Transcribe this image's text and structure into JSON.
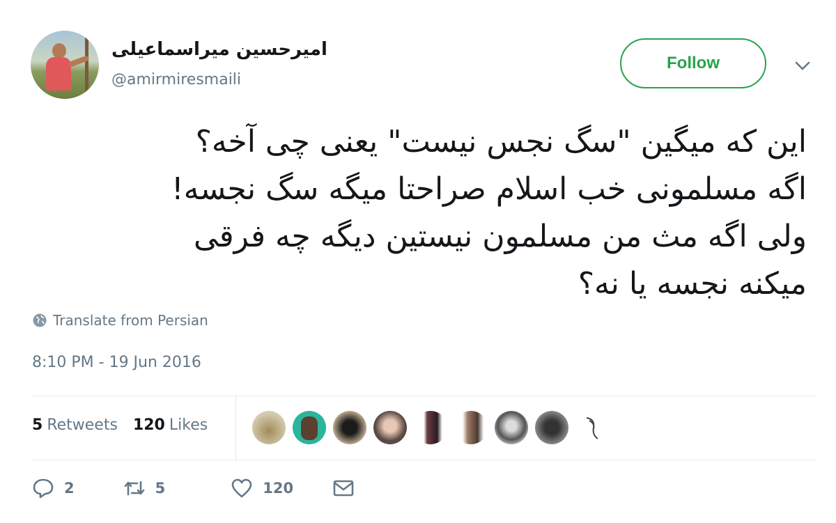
{
  "author": {
    "display_name": "امیرحسین میراسماعیلی",
    "username": "@amirmiresmaili",
    "avatar": "user-avatar"
  },
  "follow_button": {
    "label": "Follow",
    "color": "#27a34a"
  },
  "menu": {
    "icon": "chevron-down-icon"
  },
  "tweet": {
    "lines": [
      "این که میگین \"سگ نجس نیست\" یعنی چی آخه؟",
      "اگه مسلمونی خب اسلام صراحتا میگه سگ نجسه!",
      "ولی اگه مث من مسلمون نیستین دیگه چه فرقی",
      "میکنه نجسه یا نه؟"
    ]
  },
  "translate": {
    "label": "Translate from Persian",
    "icon": "globe-icon"
  },
  "timestamp": "8:10 PM - 19 Jun 2016",
  "stats": {
    "retweets_count": "5",
    "retweets_label": "Retweets",
    "likes_count": "120",
    "likes_label": "Likes"
  },
  "liked_by": [
    "liker-avatar-1",
    "liker-avatar-2",
    "liker-avatar-3",
    "liker-avatar-4",
    "liker-avatar-5",
    "liker-avatar-6",
    "liker-avatar-7",
    "liker-avatar-8",
    "liker-avatar-9"
  ],
  "actions": {
    "reply": {
      "icon": "reply-icon",
      "count": "2"
    },
    "retweet": {
      "icon": "retweet-icon",
      "count": "5"
    },
    "like": {
      "icon": "heart-icon",
      "count": "120"
    },
    "message": {
      "icon": "envelope-icon"
    }
  }
}
